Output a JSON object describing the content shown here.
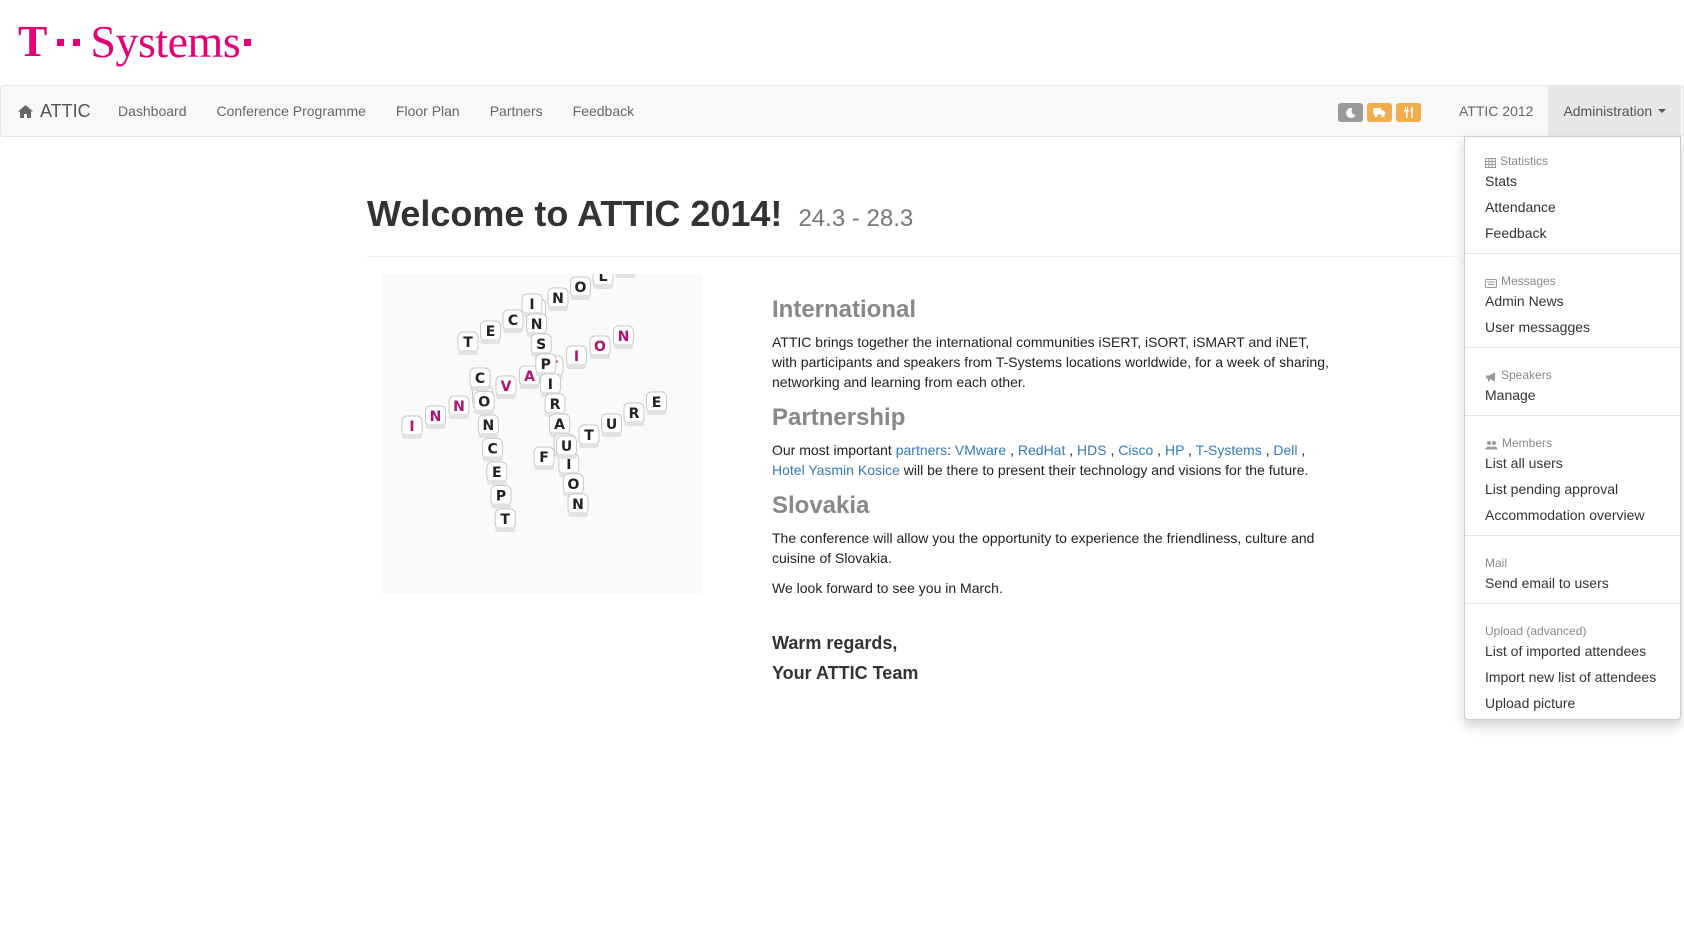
{
  "brand": {
    "t": "T",
    "name": "Systems"
  },
  "navbar": {
    "brand_label": "ATTIC",
    "links": [
      "Dashboard",
      "Conference Programme",
      "Floor Plan",
      "Partners",
      "Feedback"
    ],
    "right_links": [
      "ATTIC 2012",
      "Administration"
    ],
    "icons": [
      "moon-icon",
      "truck-icon",
      "cutlery-icon"
    ]
  },
  "dropdown": {
    "statistics": {
      "header": "Statistics",
      "items": [
        "Stats",
        "Attendance",
        "Feedback"
      ]
    },
    "messages": {
      "header": "Messages",
      "items": [
        "Admin News",
        "User messagges"
      ]
    },
    "speakers": {
      "header": "Speakers",
      "items": [
        "Manage"
      ]
    },
    "members": {
      "header": "Members",
      "items": [
        "List all users",
        "List pending approval",
        "Accommodation overview"
      ]
    },
    "mail": {
      "header": "Mail",
      "items": [
        "Send email to users"
      ]
    },
    "upload": {
      "header": "Upload (advanced)",
      "items": [
        "List of imported attendees",
        "Import new list of attendees",
        "Upload picture"
      ]
    }
  },
  "main": {
    "title": "Welcome to ATTIC 2014!",
    "dates": "24.3 - 28.3",
    "hero_words": [
      "TECHNOLOGY",
      "INNOVATION",
      "CONCEPT",
      "INSPIRATION",
      "FUTURE"
    ],
    "international": {
      "heading": "International",
      "text": "ATTIC brings together the international communities iSERT, iSORT, iSMART and iNET, with participants and speakers from T-Systems locations worldwide, for a week of sharing, networking and learning from each other."
    },
    "partnership": {
      "heading": "Partnership",
      "intro": "Our most important",
      "partners_link": "partners",
      "partners": [
        "VMware",
        "RedHat",
        "HDS",
        "Cisco",
        "HP",
        "T-Systems",
        "Dell",
        "Hotel Yasmin Kosice"
      ],
      "outro": "will be there to present their technology and visions for the future."
    },
    "slovakia": {
      "heading": "Slovakia",
      "text": "The conference will allow you the opportunity to experience the friendliness, culture and cuisine of Slovakia.",
      "text2": "We look forward to see you in March."
    },
    "regards": {
      "line1": "Warm regards,",
      "line2": "Your ATTIC Team"
    }
  }
}
